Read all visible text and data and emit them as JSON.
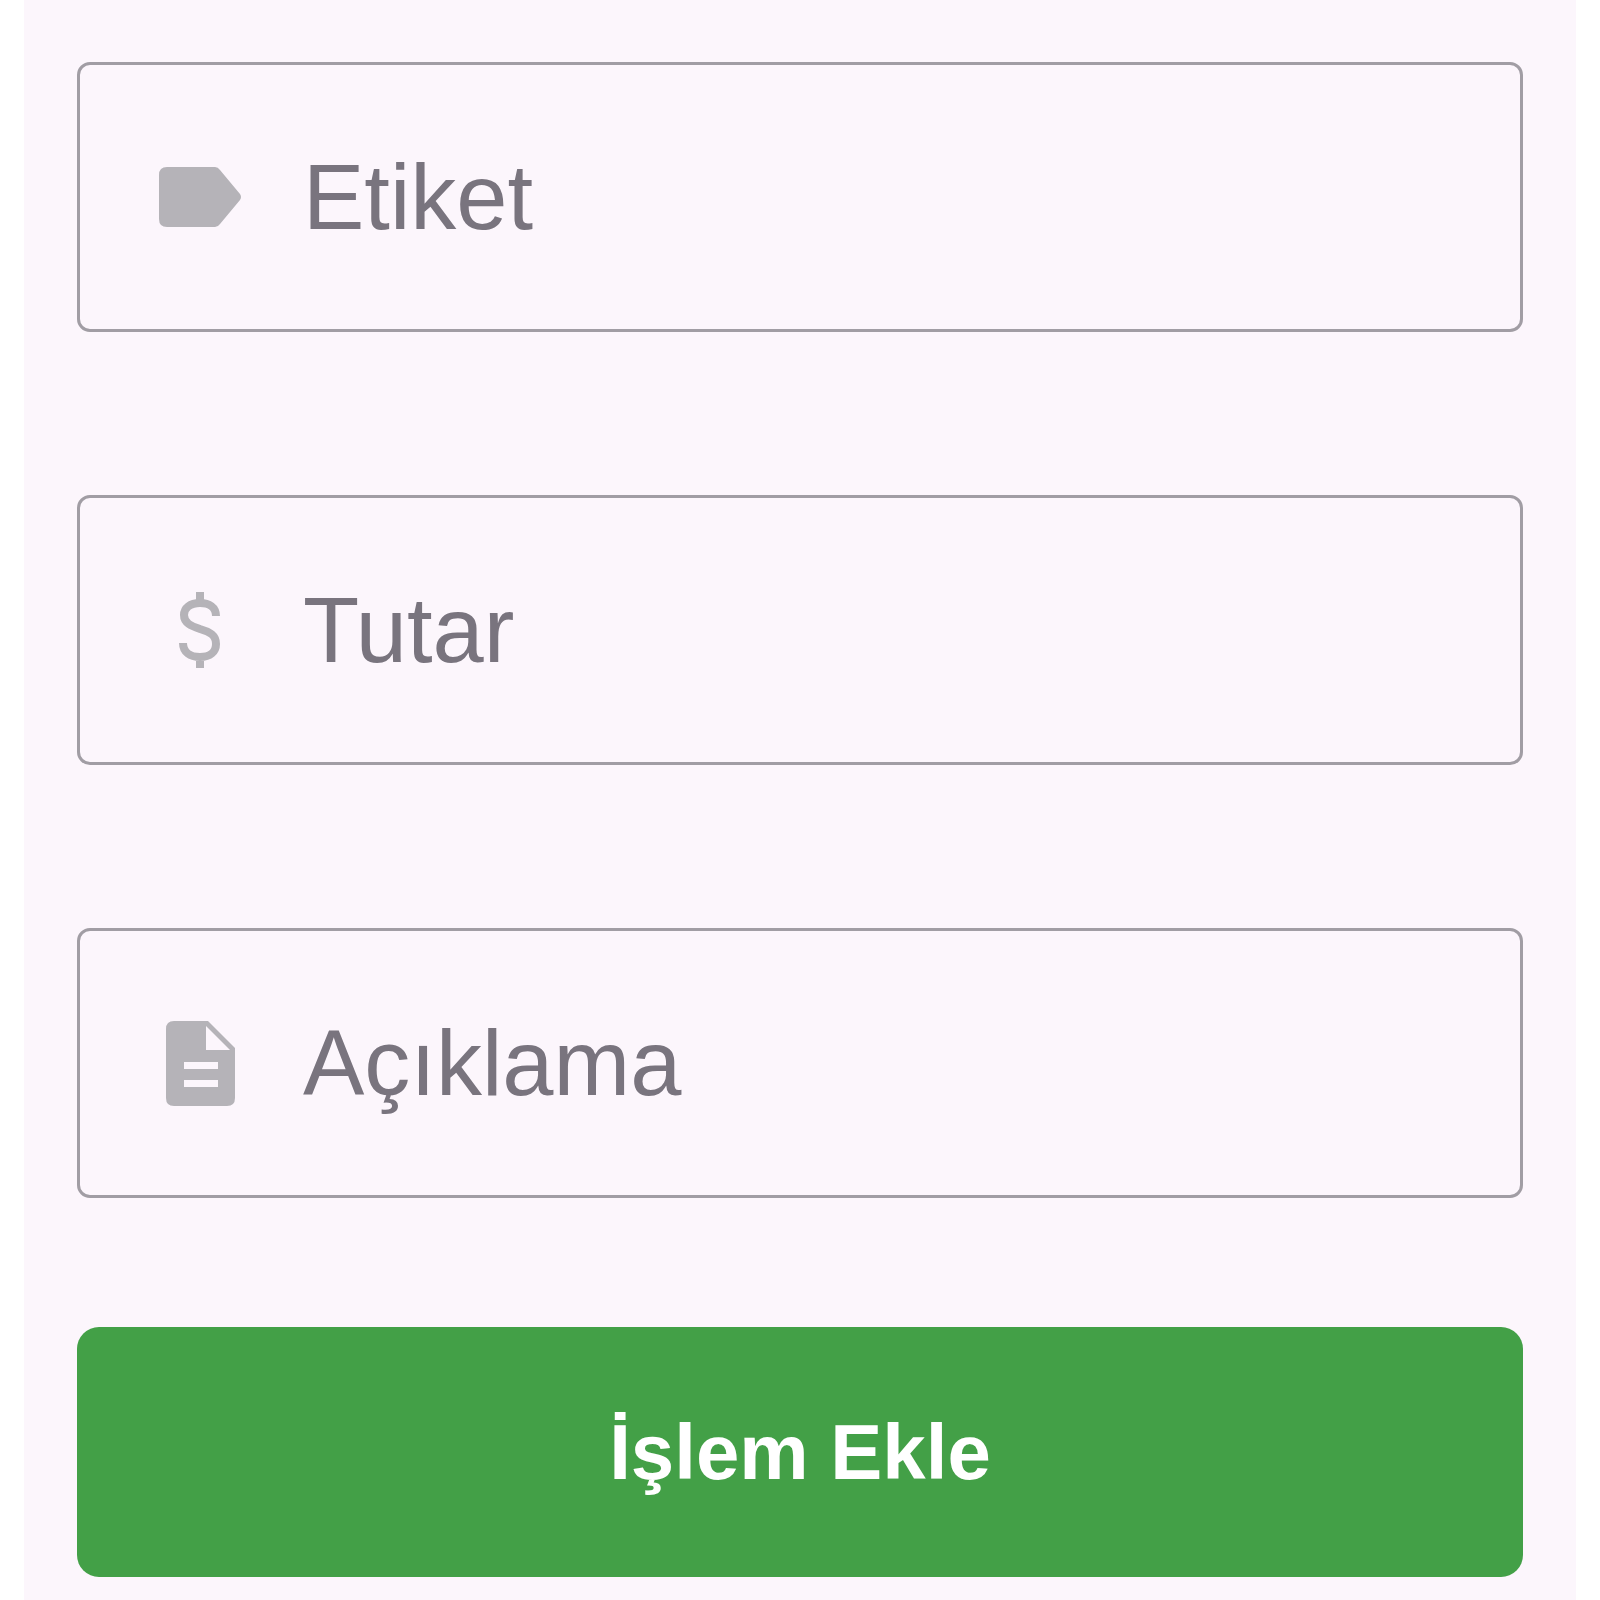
{
  "fields": [
    {
      "kind": "tag",
      "placeholder": "Etiket"
    },
    {
      "kind": "money",
      "placeholder": "Tutar"
    },
    {
      "kind": "document",
      "placeholder": "Açıklama"
    }
  ],
  "submit_button": {
    "label": "İşlem Ekle"
  }
}
